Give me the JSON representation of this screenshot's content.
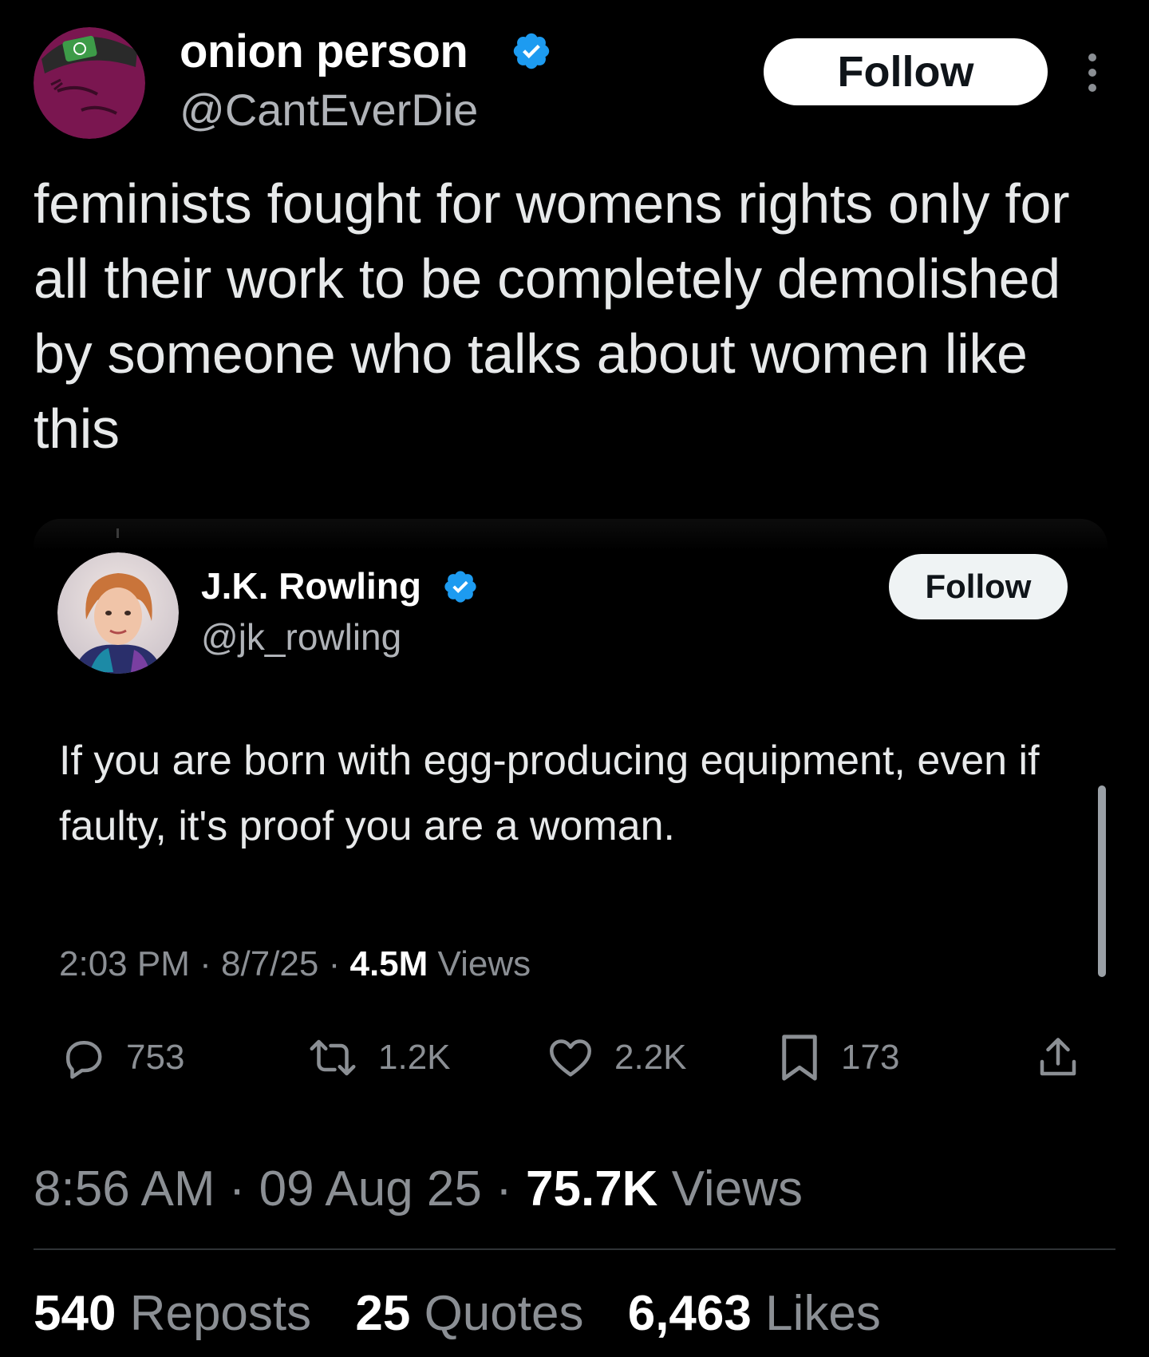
{
  "post": {
    "author": {
      "display_name": "onion person",
      "handle": "@CantEverDie",
      "verified": true,
      "avatar_icon": "cartoon-avatar-icon"
    },
    "follow_label": "Follow",
    "more_icon": "more-vertical-icon",
    "text": "feminists fought for womens rights only for all their work to be completely demolished by someone who talks about women like this",
    "time": "8:56 AM",
    "date": "09 Aug 25",
    "views_count": "75.7K",
    "views_label": "Views",
    "sep": "·"
  },
  "quote": {
    "author": {
      "display_name": "J.K. Rowling",
      "handle": "@jk_rowling",
      "verified": true,
      "avatar_icon": "profile-photo-icon"
    },
    "follow_label": "Follow",
    "text": "If you are born with egg-producing equipment, even if faulty, it's proof you are a woman.",
    "time": "2:03 PM",
    "date": "8/7/25",
    "views_count": "4.5M",
    "views_label": "Views",
    "sep": "·",
    "actions": {
      "replies": "753",
      "reposts": "1.2K",
      "likes": "2.2K",
      "bookmarks": "173"
    }
  },
  "stats": {
    "reposts_count": "540",
    "reposts_label": "Reposts",
    "quotes_count": "25",
    "quotes_label": "Quotes",
    "likes_count": "6,463",
    "likes_label": "Likes"
  },
  "colors": {
    "background": "#000000",
    "primary_text": "#e7e9ea",
    "secondary_text": "#8b8f94",
    "verified_blue": "#1d9bf0",
    "avatar_purple": "#7a1650"
  }
}
